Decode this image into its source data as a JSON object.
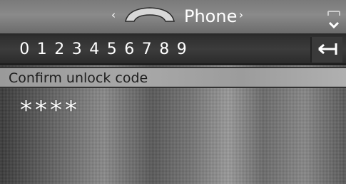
{
  "header": {
    "title": "Phone",
    "prev_arrow": "‹",
    "next_arrow": "›"
  },
  "keypad": {
    "digits": [
      "0",
      "1",
      "2",
      "3",
      "4",
      "5",
      "6",
      "7",
      "8",
      "9"
    ]
  },
  "prompt": {
    "label": "Confirm unlock code"
  },
  "code_entry": {
    "masked_value": "****"
  },
  "icons": {
    "title": "phone-handset-icon",
    "expand": "expand-down-icon",
    "backspace": "backspace-icon"
  }
}
